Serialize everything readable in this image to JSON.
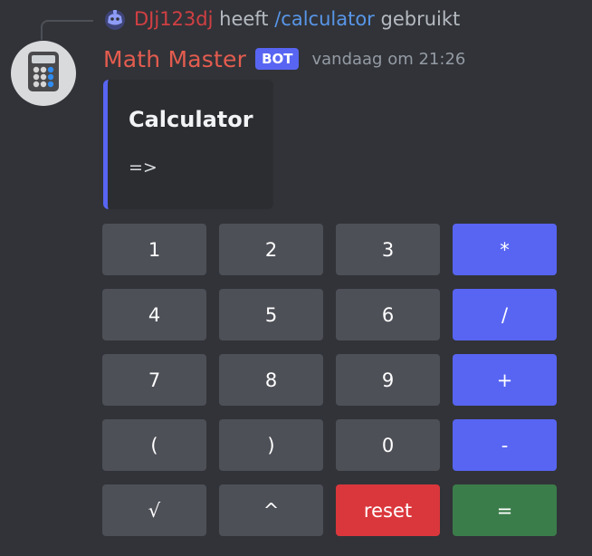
{
  "reply": {
    "username": "DJj123dj",
    "text_before": " heeft ",
    "command": "/calculator",
    "text_after": " gebruikt"
  },
  "message": {
    "author": "Math Master",
    "bot_tag": "BOT",
    "timestamp": "vandaag om 21:26"
  },
  "embed": {
    "title": "Calculator",
    "description": "=>",
    "accent_color": "#5865f2"
  },
  "keypad": {
    "rows": [
      [
        {
          "label": "1",
          "style": "secondary"
        },
        {
          "label": "2",
          "style": "secondary"
        },
        {
          "label": "3",
          "style": "secondary"
        },
        {
          "label": "*",
          "style": "primary"
        }
      ],
      [
        {
          "label": "4",
          "style": "secondary"
        },
        {
          "label": "5",
          "style": "secondary"
        },
        {
          "label": "6",
          "style": "secondary"
        },
        {
          "label": "/",
          "style": "primary"
        }
      ],
      [
        {
          "label": "7",
          "style": "secondary"
        },
        {
          "label": "8",
          "style": "secondary"
        },
        {
          "label": "9",
          "style": "secondary"
        },
        {
          "label": "+",
          "style": "primary"
        }
      ],
      [
        {
          "label": "(",
          "style": "secondary"
        },
        {
          "label": ")",
          "style": "secondary"
        },
        {
          "label": "0",
          "style": "secondary"
        },
        {
          "label": "-",
          "style": "primary"
        }
      ],
      [
        {
          "label": "√",
          "style": "secondary"
        },
        {
          "label": "^",
          "style": "secondary"
        },
        {
          "label": "reset",
          "style": "danger"
        },
        {
          "label": "=",
          "style": "success"
        }
      ]
    ]
  },
  "colors": {
    "background": "#313338",
    "embed_background": "#2b2d31",
    "blurple": "#5865f2",
    "secondary_button": "#4e5058",
    "danger_button": "#da373c",
    "success_button": "#3b7d4a",
    "author": "#e45c4f"
  },
  "icons": {
    "reply_icon": "discord-bot-icon",
    "avatar": "calculator-icon"
  }
}
